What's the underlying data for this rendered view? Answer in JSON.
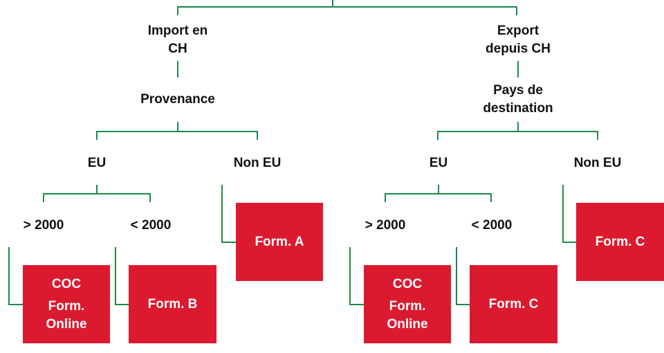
{
  "colors": {
    "connector": "#1a8a4a",
    "box": "#dc1a2f",
    "box_text": "#ffffff",
    "label_text": "#111111"
  },
  "import": {
    "title_l1": "Import en",
    "title_l2": "CH",
    "criterion": "Provenance",
    "eu": {
      "label": "EU",
      "gt": {
        "label": "> 2000",
        "result_l1": "COC",
        "result_l2": "Form.",
        "result_l3": "Online"
      },
      "lt": {
        "label": "< 2000",
        "result": "Form. B"
      }
    },
    "non_eu": {
      "label": "Non EU",
      "result": "Form. A"
    }
  },
  "export": {
    "title_l1": "Export",
    "title_l2": "depuis CH",
    "criterion_l1": "Pays de",
    "criterion_l2": "destination",
    "eu": {
      "label": "EU",
      "gt": {
        "label": "> 2000",
        "result_l1": "COC",
        "result_l2": "Form.",
        "result_l3": "Online"
      },
      "lt": {
        "label": "< 2000",
        "result": "Form. C"
      }
    },
    "non_eu": {
      "label": "Non EU",
      "result": "Form. C"
    }
  }
}
